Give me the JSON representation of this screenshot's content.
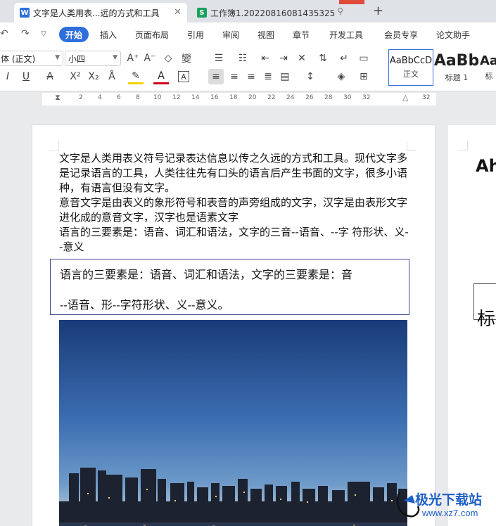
{
  "tabs": [
    {
      "label": "文字是人类用表...远的方式和工具",
      "icon": "word-doc-icon",
      "color": "#2f6fdd"
    },
    {
      "label": "工作簿1.20220816081435325",
      "icon": "spreadsheet-icon",
      "color": "#1aa260"
    }
  ],
  "menu": [
    "开始",
    "插入",
    "页面布局",
    "引用",
    "审阅",
    "视图",
    "章节",
    "开发工具",
    "会员专享",
    "论文助手"
  ],
  "ribbon": {
    "font_name": "体 (正文)",
    "font_size": "小四",
    "styles": [
      {
        "sample": "AaBbCcD",
        "name": "正文"
      },
      {
        "sample": "AaBb",
        "name": "标题 1"
      },
      {
        "sample": "Aa",
        "name": "标"
      }
    ]
  },
  "ruler": [
    "2",
    "2",
    "4",
    "6",
    "8",
    "10",
    "12",
    "14",
    "16",
    "18",
    "20",
    "22",
    "24",
    "26",
    "28",
    "30",
    "32"
  ],
  "document": {
    "paragraphs": [
      "文字是人类用表义符号记录表达信息以传之久远的方式和工具。现代文字多是记录语言的工具，人类往往先有口头的语言后产生书面的文字，很多小语种，有语言但没有文字。",
      "意音文字是由表义的象形符号和表音的声旁组成的文字，汉字是由表形文字进化成的意音文字，汉字也是语素文字",
      "语言的三要素是：语音、词汇和语法，文字的三音--语音、--字  符形状、义--意义"
    ],
    "textbox_lines": [
      "语言的三要素是：语音、词汇和语法，文字的三要素是：音",
      "--语音、形--字符形状、义--意义。"
    ]
  },
  "page2": {
    "heading": "Ah",
    "char": "标"
  },
  "watermark": {
    "title": "极光下载站",
    "url": "www.xz7.com"
  }
}
